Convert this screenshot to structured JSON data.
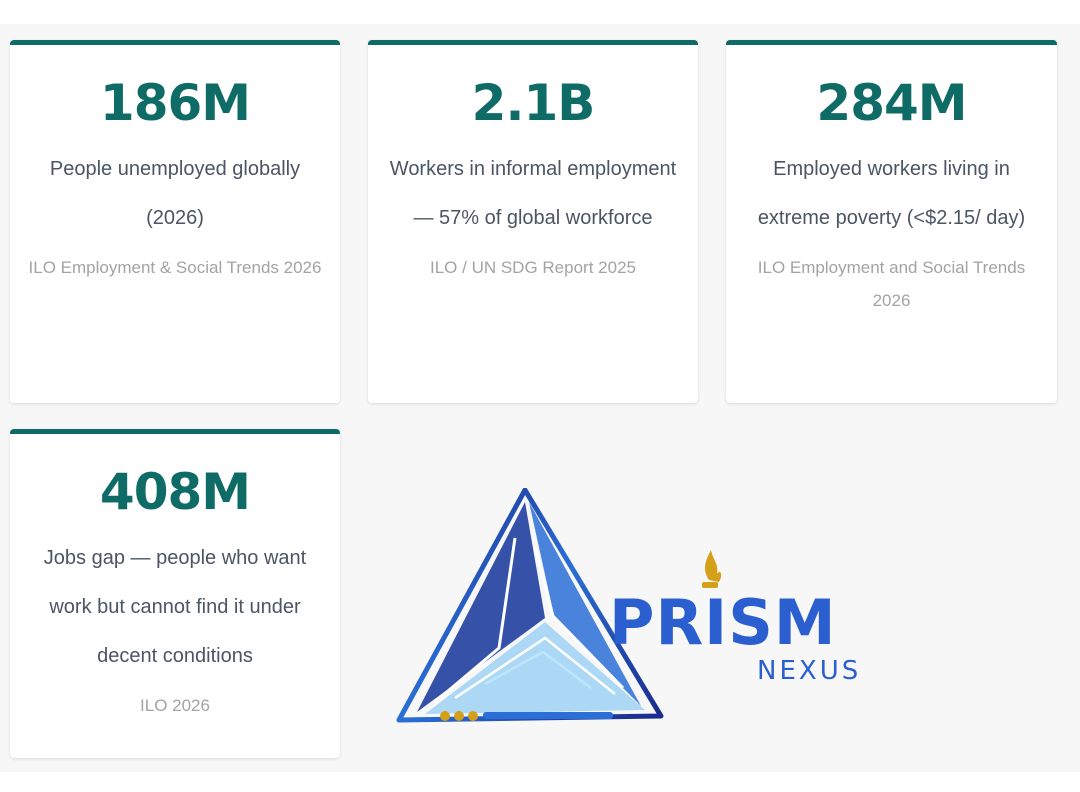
{
  "stats": [
    {
      "value": "186M",
      "description": "People unemployed globally (2026)",
      "source": "ILO Employment & Social Trends 2026"
    },
    {
      "value": "2.1B",
      "description": "Workers in informal employment — 57% of global workforce",
      "source": "ILO / UN SDG Report 2025"
    },
    {
      "value": "284M",
      "description": "Employed workers living in extreme poverty (<$2.15/ day)",
      "source": "ILO Employment and Social Trends 2026"
    },
    {
      "value": "408M",
      "description": "Jobs gap — people who want work but cannot find it under decent conditions",
      "source": "ILO 2026"
    }
  ],
  "logo": {
    "wordmark": "PRISM",
    "subtitle": "NEXUS"
  },
  "colors": {
    "accent": "#0f6b66",
    "card_background": "#ffffff",
    "page_background": "#f7f7f7",
    "description_text": "#4b5563",
    "source_text": "#a3a3a3",
    "logo_blue": "#2b6fd6",
    "logo_navy": "#1a2a8a",
    "logo_gold": "#d4a017"
  }
}
